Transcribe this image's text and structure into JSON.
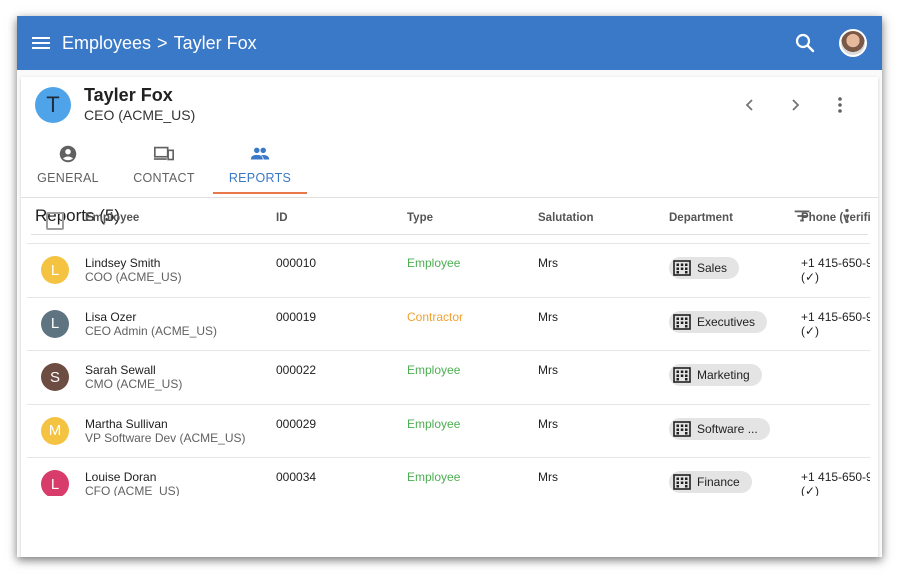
{
  "appbar": {
    "breadcrumb_root": "Employees",
    "breadcrumb_sep": ">",
    "breadcrumb_current": "Tayler Fox",
    "color": "#3a78c8"
  },
  "person": {
    "initial": "T",
    "name": "Tayler Fox",
    "role": "CEO (ACME_US)"
  },
  "tabs": [
    {
      "label": "GENERAL",
      "icon": "account-circle-icon"
    },
    {
      "label": "CONTACT",
      "icon": "devices-icon"
    },
    {
      "label": "REPORTS",
      "icon": "people-icon",
      "active": true
    }
  ],
  "section": {
    "title": "Reports (5)"
  },
  "table": {
    "headers": [
      "Employee",
      "ID",
      "Type",
      "Salutation",
      "Department",
      "Phone (verifie"
    ],
    "rows": [
      {
        "initial": "L",
        "avatar_color": "#f5c342",
        "name": "Lindsey Smith",
        "sub": "COO (ACME_US)",
        "id": "000010",
        "type": "Employee",
        "type_color": "#4caf50",
        "salutation": "Mrs",
        "department": "Sales",
        "phone": "+1 415-650-9",
        "verified": "(✓)"
      },
      {
        "initial": "L",
        "avatar_color": "#5f7481",
        "name": "Lisa Ozer",
        "sub": "CEO Admin (ACME_US)",
        "id": "000019",
        "type": "Contractor",
        "type_color": "#f0a030",
        "salutation": "Mrs",
        "department": "Executives",
        "phone": "+1 415-650-9",
        "verified": "(✓)"
      },
      {
        "initial": "S",
        "avatar_color": "#6d4c41",
        "name": "Sarah Sewall",
        "sub": "CMO (ACME_US)",
        "id": "000022",
        "type": "Employee",
        "type_color": "#4caf50",
        "salutation": "Mrs",
        "department": "Marketing",
        "phone": "",
        "verified": ""
      },
      {
        "initial": "M",
        "avatar_color": "#f5c342",
        "name": "Martha Sullivan",
        "sub": "VP Software Dev (ACME_US)",
        "id": "000029",
        "type": "Employee",
        "type_color": "#4caf50",
        "salutation": "Mrs",
        "department": "Software ...",
        "phone": "",
        "verified": ""
      },
      {
        "initial": "L",
        "avatar_color": "#d83c6a",
        "name": "Louise Doran",
        "sub": "CFO (ACME_US)",
        "id": "000034",
        "type": "Employee",
        "type_color": "#4caf50",
        "salutation": "Mrs",
        "department": "Finance",
        "phone": "+1 415-650-9",
        "verified": "(✓)"
      }
    ]
  }
}
